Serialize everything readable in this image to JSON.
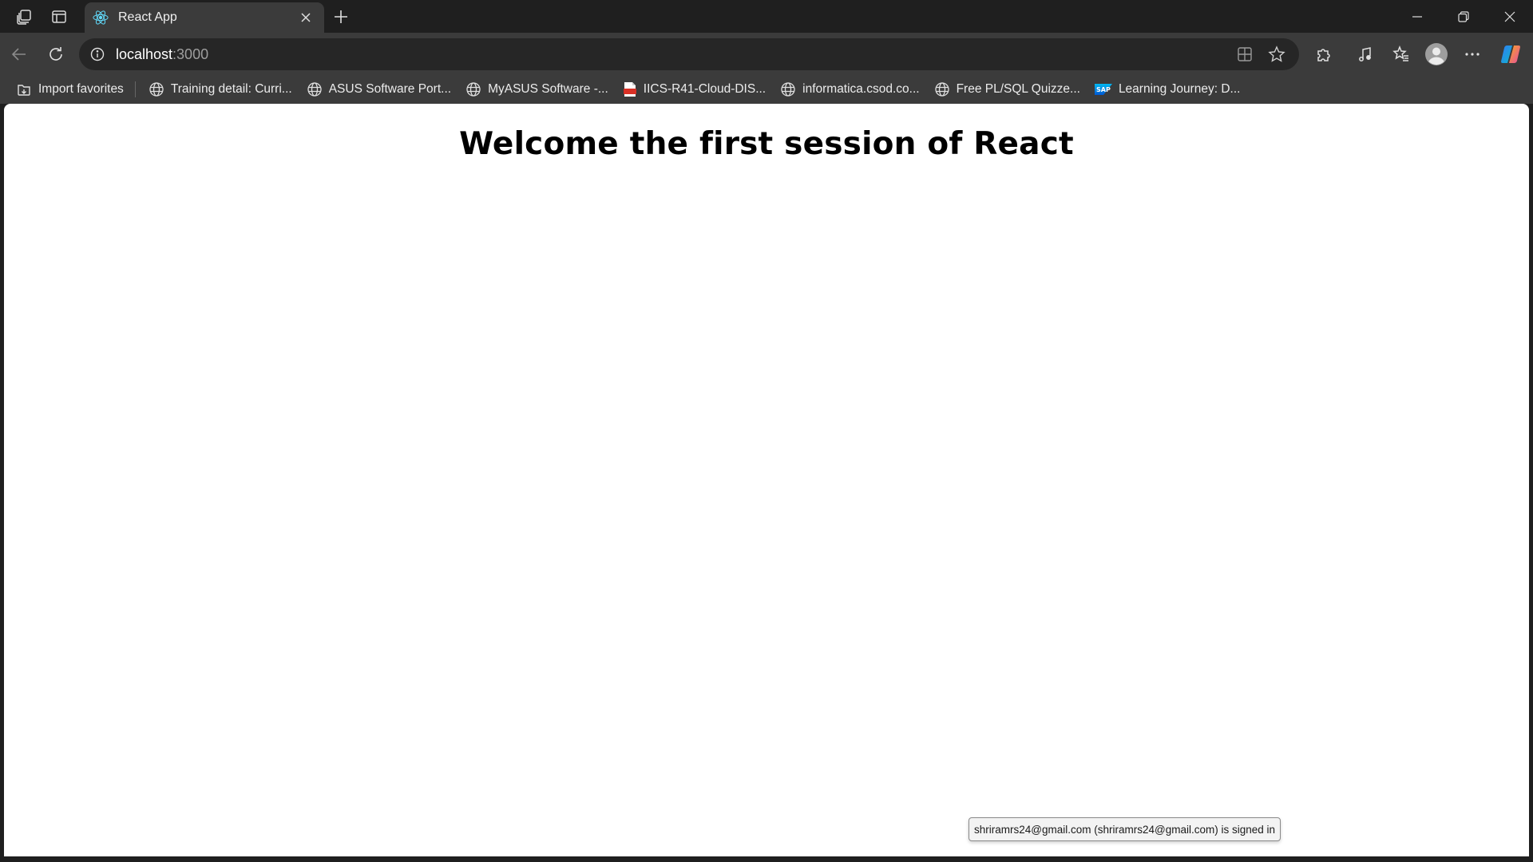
{
  "tab": {
    "title": "React App",
    "favicon": "react-atom-icon",
    "close_label": "×"
  },
  "address_bar": {
    "host": "localhost",
    "port": ":3000",
    "info_icon": "info-icon"
  },
  "bookmarks": [
    {
      "label": "Import favorites",
      "icon": "import-favorites-icon"
    },
    {
      "label": "Training detail: Curri...",
      "icon": "globe-icon"
    },
    {
      "label": "ASUS Software Port...",
      "icon": "globe-icon"
    },
    {
      "label": "MyASUS Software -...",
      "icon": "globe-icon"
    },
    {
      "label": "IICS-R41-Cloud-DIS...",
      "icon": "pdf-icon"
    },
    {
      "label": "informatica.csod.co...",
      "icon": "globe-icon"
    },
    {
      "label": "Free PL/SQL Quizze...",
      "icon": "globe-icon"
    },
    {
      "label": "Learning Journey: D...",
      "icon": "sap-icon"
    }
  ],
  "page": {
    "heading": "Welcome the first session of React"
  },
  "tooltip": {
    "text": "shriramrs24@gmail.com (shriramrs24@gmail.com) is signed in"
  },
  "colors": {
    "chrome_dark": "#1f1f1f",
    "toolbar": "#3b3b3b",
    "omnibox": "#262626",
    "page_bg": "#ffffff",
    "react_blue": "#61dafb",
    "copilot_gradient_a": "#2f7cf6",
    "copilot_gradient_b": "#e84ea0"
  }
}
